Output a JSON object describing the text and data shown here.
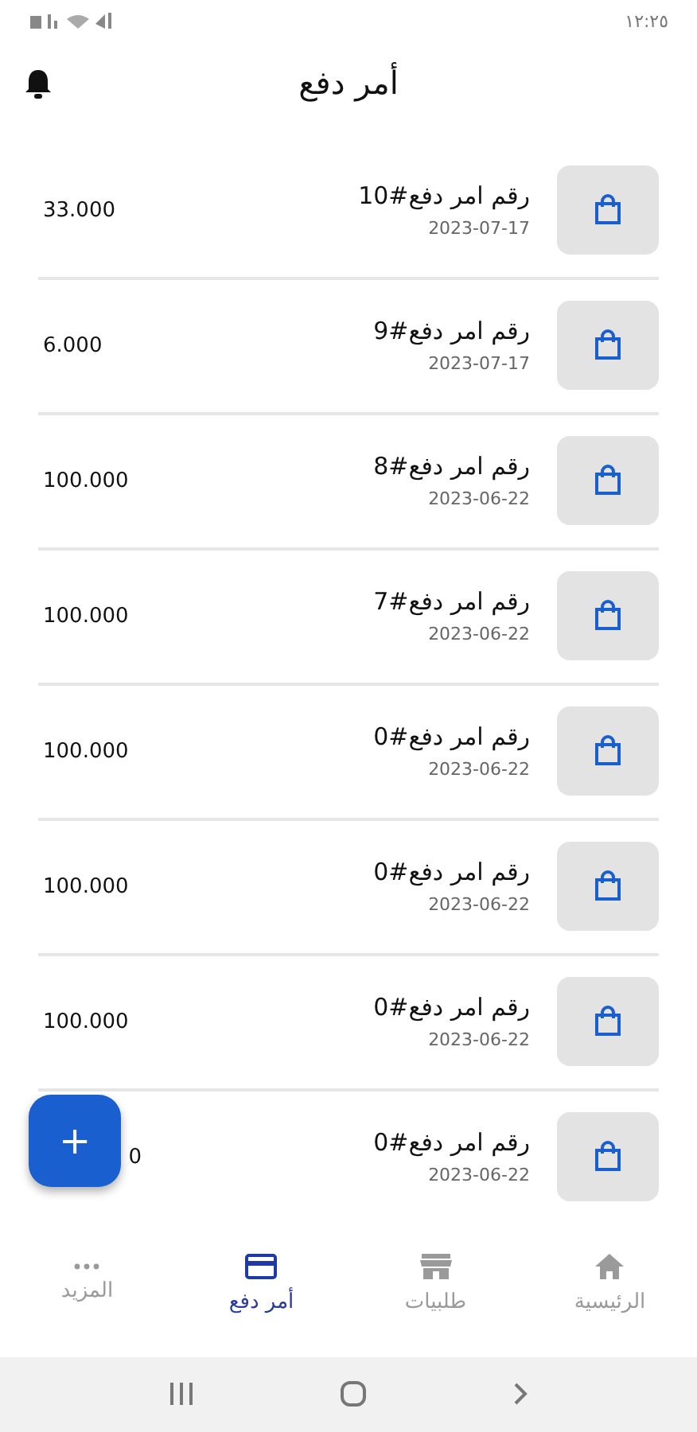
{
  "status_bar": {
    "time": "١٢:٢٥"
  },
  "header": {
    "title": "أمر دفع"
  },
  "orders": [
    {
      "title": "رقم امر دفع#10",
      "date": "2023-07-17",
      "amount": "33.000"
    },
    {
      "title": "رقم امر دفع#9",
      "date": "2023-07-17",
      "amount": "6.000"
    },
    {
      "title": "رقم امر دفع#8",
      "date": "2023-06-22",
      "amount": "100.000"
    },
    {
      "title": "رقم امر دفع#7",
      "date": "2023-06-22",
      "amount": "100.000"
    },
    {
      "title": "رقم امر دفع#0",
      "date": "2023-06-22",
      "amount": "100.000"
    },
    {
      "title": "رقم امر دفع#0",
      "date": "2023-06-22",
      "amount": "100.000"
    },
    {
      "title": "رقم امر دفع#0",
      "date": "2023-06-22",
      "amount": "100.000"
    },
    {
      "title": "رقم امر دفع#0",
      "date": "2023-06-22",
      "amount": "0"
    }
  ],
  "fab": {
    "label": "+"
  },
  "bottom_nav": [
    {
      "kind": "home",
      "label": "الرئيسية",
      "selected": false
    },
    {
      "kind": "store",
      "label": "طلبيات",
      "selected": false
    },
    {
      "kind": "card",
      "label": "أمر دفع",
      "selected": true
    },
    {
      "kind": "more",
      "label": "المزيد",
      "selected": false
    }
  ]
}
